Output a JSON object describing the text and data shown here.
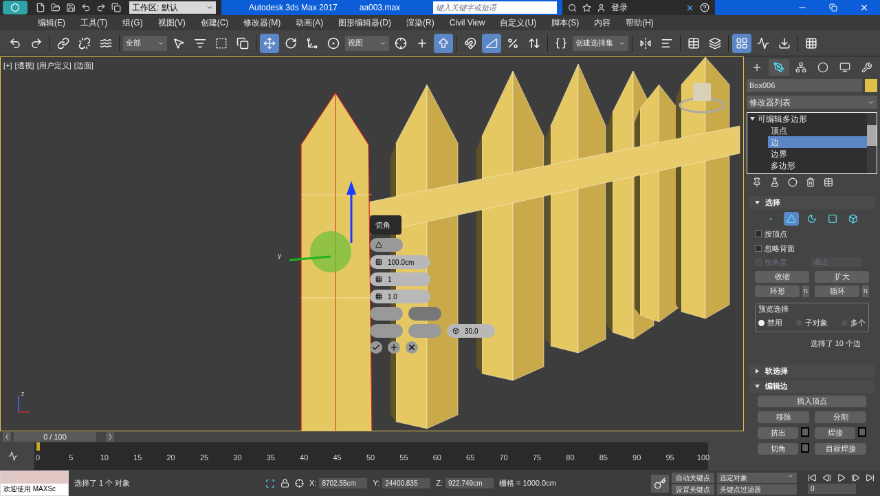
{
  "title_bar": {
    "workspace": "工作区: 默认",
    "app_title": "Autodesk 3ds Max 2017",
    "file_name": "aa003.max",
    "search": {
      "placeholder": "键入关键字或短语"
    },
    "login": "登录"
  },
  "menu": [
    "编辑(E)",
    "工具(T)",
    "组(G)",
    "视图(V)",
    "创建(C)",
    "修改器(M)",
    "动画(A)",
    "图形编辑器(D)",
    "渲染(R)",
    "Civil View",
    "自定义(U)",
    "脚本(S)",
    "内容",
    "帮助(H)"
  ],
  "toolbar": [
    {
      "kind": "tool",
      "selected": false
    },
    {
      "kind": "tool",
      "selected": false
    },
    {
      "kind": "separator"
    },
    {
      "kind": "tool",
      "selected": false
    },
    {
      "kind": "tool",
      "selected": false
    },
    {
      "kind": "tool",
      "selected": false
    },
    {
      "kind": "separator"
    },
    {
      "kind": "dropdown",
      "value": "全部"
    },
    {
      "kind": "tool",
      "selected": false
    },
    {
      "kind": "tool",
      "selected": false
    },
    {
      "kind": "tool",
      "selected": false
    },
    {
      "kind": "tool",
      "selected": false
    },
    {
      "kind": "separator"
    },
    {
      "kind": "tool",
      "selected": true
    },
    {
      "kind": "tool",
      "selected": false
    },
    {
      "kind": "tool",
      "selected": false
    },
    {
      "kind": "tool",
      "selected": false
    },
    {
      "kind": "dropdown",
      "value": "视图"
    },
    {
      "kind": "tool",
      "selected": false
    },
    {
      "kind": "tool",
      "selected": false
    },
    {
      "kind": "tool",
      "selected": true
    },
    {
      "kind": "separator"
    },
    {
      "kind": "tool",
      "selected": false
    },
    {
      "kind": "tool",
      "selected": true
    },
    {
      "kind": "tool",
      "selected": false
    },
    {
      "kind": "tool",
      "selected": false
    },
    {
      "kind": "separator"
    },
    {
      "kind": "tool",
      "selected": false
    },
    {
      "kind": "dropdown",
      "value": "创建选择集"
    },
    {
      "kind": "separator"
    },
    {
      "kind": "tool",
      "selected": false
    },
    {
      "kind": "tool",
      "selected": false
    },
    {
      "kind": "separator"
    },
    {
      "kind": "tool",
      "selected": false
    },
    {
      "kind": "tool",
      "selected": false
    },
    {
      "kind": "separator"
    },
    {
      "kind": "tool",
      "selected": true
    },
    {
      "kind": "tool",
      "selected": false
    },
    {
      "kind": "tool",
      "selected": false
    },
    {
      "kind": "separator"
    },
    {
      "kind": "tool",
      "selected": false
    }
  ],
  "viewport": {
    "labels": [
      "[+]",
      "[透视]",
      "[用户定义]",
      "[边面]"
    ],
    "active": true,
    "gizmo_label": "y",
    "world_axis_label": "z"
  },
  "caddy": {
    "title": "切角",
    "fields": [
      "100.0cm",
      "1",
      "1.0",
      "30.0"
    ]
  },
  "command_panel": {
    "tabs": [
      {
        "selected": false
      },
      {
        "selected": true
      },
      {
        "selected": false
      },
      {
        "selected": false
      },
      {
        "selected": false
      },
      {
        "selected": false
      }
    ],
    "object_name": "Box006",
    "modifier_list": "修改器列表",
    "stack": [
      {
        "label": "可编辑多边形",
        "expanded": true,
        "selected": false,
        "children": [
          {
            "label": "顶点",
            "selected": false
          },
          {
            "label": "边",
            "selected": true
          },
          {
            "label": "边界",
            "selected": false
          },
          {
            "label": "多边形",
            "selected": false
          }
        ]
      }
    ],
    "rollouts": [
      {
        "kind": "selection",
        "title": "选择",
        "expanded": true,
        "modes": [
          {
            "selected": false
          },
          {
            "selected": true
          },
          {
            "selected": false
          },
          {
            "selected": false
          },
          {
            "selected": false
          }
        ],
        "checks": [
          {
            "label": "按顶点",
            "checked": false,
            "disabled": false
          },
          {
            "label": "忽略背面",
            "checked": false,
            "disabled": false
          },
          {
            "label": "按角度:",
            "checked": false,
            "disabled": true,
            "value": "45.0"
          }
        ],
        "buttons": [
          "收缩",
          "扩大"
        ],
        "spin_buttons": [
          "环形",
          "循环"
        ],
        "preview": {
          "title": "预览选择",
          "options": [
            {
              "label": "禁用",
              "selected": true
            },
            {
              "label": "子对象",
              "selected": false
            },
            {
              "label": "多个",
              "selected": false
            }
          ]
        },
        "summary": "选择了 10 个边"
      },
      {
        "kind": "soft",
        "title": "软选择",
        "expanded": false
      },
      {
        "kind": "edit_edges",
        "title": "编辑边",
        "expanded": true,
        "buttons": [
          {
            "label": "插入顶点",
            "wide": true,
            "settings": false
          },
          {
            "label": "移除",
            "wide": false,
            "settings": false
          },
          {
            "label": "分割",
            "wide": false,
            "settings": false
          },
          {
            "label": "挤出",
            "wide": false,
            "settings": true
          },
          {
            "label": "焊接",
            "wide": false,
            "settings": true
          },
          {
            "label": "切角",
            "wide": false,
            "settings": true
          },
          {
            "label": "目标焊接",
            "wide": false,
            "settings": false
          }
        ]
      }
    ]
  },
  "timeline": {
    "slider": {
      "text": "0 / 100",
      "level": 0
    },
    "ticks": [
      "0",
      "5",
      "10",
      "15",
      "20",
      "25",
      "30",
      "35",
      "40",
      "45",
      "50",
      "55",
      "60",
      "65",
      "70",
      "75",
      "80",
      "85",
      "90",
      "95",
      "100"
    ]
  },
  "status": {
    "script_listener": "欢迎使用 MAXSc",
    "prompt": "选择了 1 个 对象",
    "coords": [
      {
        "label": "X:",
        "value": "8702.55cm"
      },
      {
        "label": "Y:",
        "value": "24400.835"
      },
      {
        "label": "Z:",
        "value": "922.749cm"
      }
    ],
    "grid": "栅格 = 1000.0cm",
    "auto_key": "自动关键点",
    "key_mode": "选定对象",
    "set_key": "设置关键点",
    "key_filter": "关键点过滤器",
    "current_frame": "0"
  }
}
